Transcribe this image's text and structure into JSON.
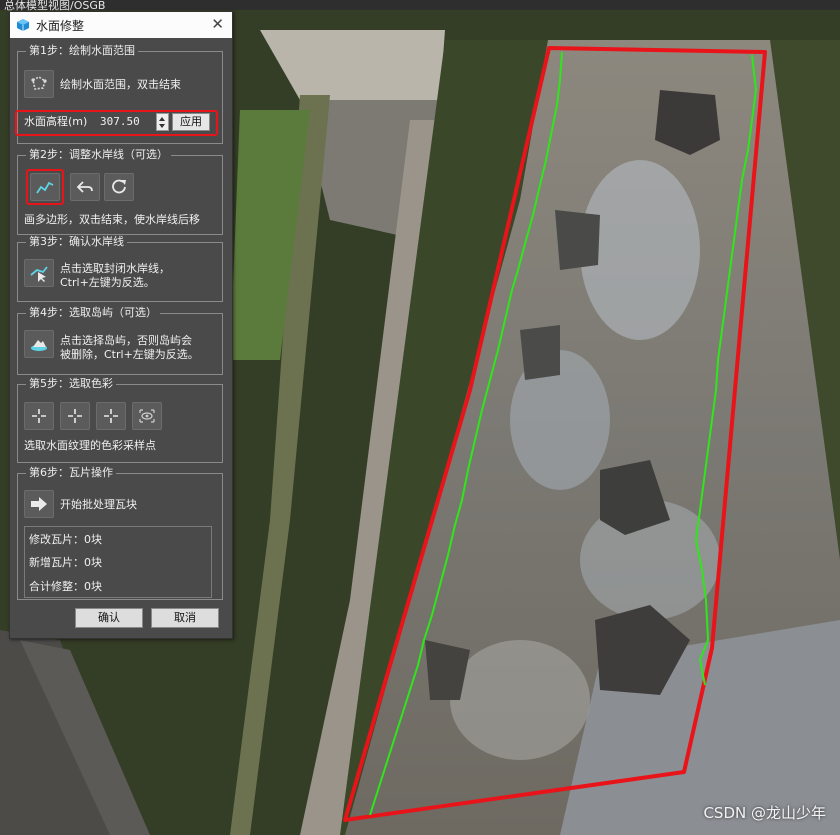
{
  "window_title": "总体模型视图/OSGB",
  "watermark": "CSDN @龙山少年",
  "dialog": {
    "title": "水面修整",
    "close_label": "✕",
    "step1": {
      "legend": "第1步：绘制水面范围",
      "draw_label": "绘制水面范围，双击结束",
      "elevation_label": "水面高程(m)",
      "elevation_value": "307.50",
      "apply_label": "应用"
    },
    "step2": {
      "legend": "第2步：调整水岸线（可选）",
      "hint": "画多边形，双击结束，使水岸线后移"
    },
    "step3": {
      "legend": "第3步：确认水岸线",
      "hint_line1": "点击选取封闭水岸线，",
      "hint_line2": "Ctrl+左键为反选。"
    },
    "step4": {
      "legend": "第4步：选取岛屿（可选）",
      "hint_line1": "点击选择岛屿，否则岛屿会",
      "hint_line2": "被删除，Ctrl+左键为反选。"
    },
    "step5": {
      "legend": "第5步：选取色彩",
      "hint": "选取水面纹理的色彩采样点"
    },
    "step6": {
      "legend": "第6步：瓦片操作",
      "batch_label": "开始批处理瓦块",
      "modified_tiles": "修改瓦片：0块",
      "new_tiles": "新增瓦片：0块",
      "total_trimmed": "合计修整：0块"
    },
    "ok_label": "确认",
    "cancel_label": "取消"
  },
  "icons": {
    "logo": "cube-logo-icon",
    "draw_area": "polygon-draw-icon",
    "adjust_shoreline": "shoreline-draw-icon",
    "undo": "undo-icon",
    "redo": "redo-icon",
    "pick_shoreline": "pick-line-icon",
    "pick_island": "island-icon",
    "color_pick": "crosshair-icon",
    "color_view": "eye-icon",
    "batch": "arrow-right-icon"
  },
  "colors": {
    "boundary": "#e8141a",
    "shoreline": "#2ee61a",
    "panel_bg": "#4a4a4a",
    "highlight": "#e8141a"
  }
}
